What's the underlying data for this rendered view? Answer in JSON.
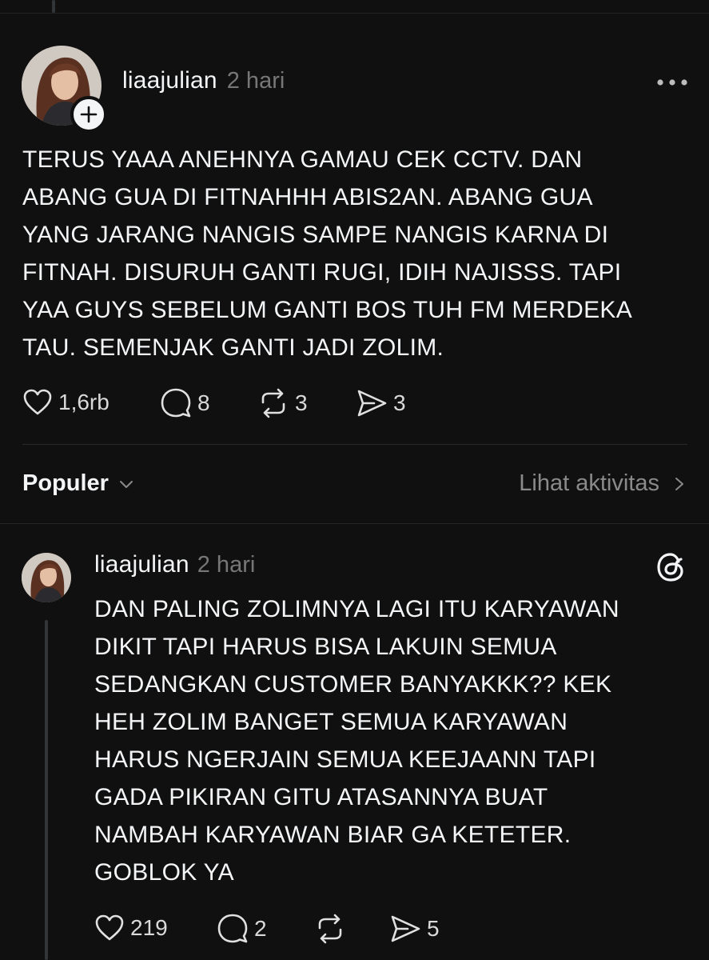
{
  "post": {
    "username": "liaajulian",
    "time": "2 hari",
    "text": "TERUS YAAA ANEHNYA GAMAU CEK CCTV. DAN\nABANG GUA DI FITNAHHH ABIS2AN. ABANG GUA\nYANG JARANG NANGIS SAMPE NANGIS KARNA DI\nFITNAH. DISURUH GANTI RUGI, IDIH NAJISSS. TAPI\nYAA GUYS SEBELUM GANTI BOS TUH FM MERDEKA\nTAU. SEMENJAK GANTI JADI ZOLIM.",
    "likes": "1,6rb",
    "replies": "8",
    "reposts": "3",
    "shares": "3"
  },
  "filter": {
    "sort_label": "Populer",
    "activity_label": "Lihat aktivitas"
  },
  "reply": {
    "username": "liaajulian",
    "time": "2 hari",
    "text": "DAN PALING ZOLIMNYA LAGI ITU KARYAWAN\nDIKIT TAPI HARUS BISA LAKUIN SEMUA\nSEDANGKAN CUSTOMER BANYAKKK?? KEK\nHEH ZOLIM BANGET SEMUA KARYAWAN\nHARUS NGERJAIN SEMUA KEEJAANN TAPI\nGADA PIKIRAN GITU ATASANNYA BUAT\nNAMBAH KARYAWAN BIAR GA KETETER.\nGOBLOK YA",
    "likes": "219",
    "replies": "2",
    "shares": "5"
  },
  "icons": {
    "more": "more-horizontal-icon",
    "follow": "plus-icon",
    "like": "heart-icon",
    "reply": "comment-icon",
    "repost": "repost-icon",
    "share": "send-icon",
    "threads": "threads-logo-icon"
  },
  "colors": {
    "background": "#101010",
    "text": "#f3f5f7",
    "muted": "#777777"
  }
}
